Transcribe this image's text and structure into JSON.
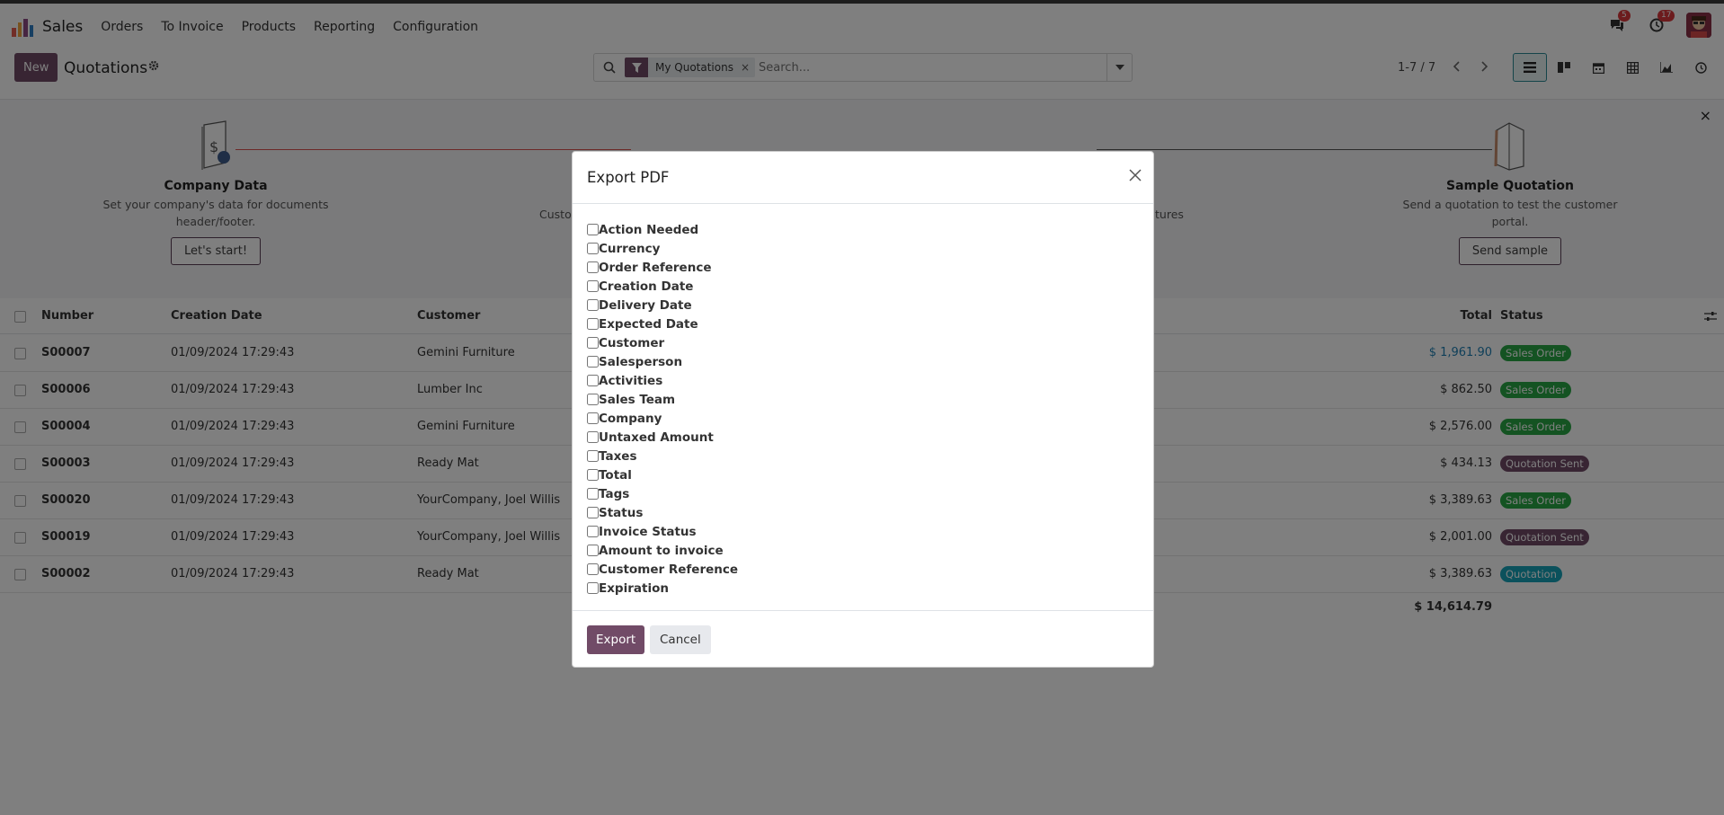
{
  "app": {
    "name": "Sales",
    "menu": [
      "Orders",
      "To Invoice",
      "Products",
      "Reporting",
      "Configuration"
    ],
    "messages_count": "5",
    "activities_count": "17"
  },
  "control": {
    "new_label": "New",
    "title": "Quotations",
    "facet_label": "My Quotations",
    "facet_remove": "×",
    "search_placeholder": "Search...",
    "pager": "1-7 / 7"
  },
  "onboarding": {
    "close": "×",
    "steps": [
      {
        "title": "Company Data",
        "desc_line1": "Set your company's data for documents",
        "desc_line2": "header/footer.",
        "button": "Let's start!"
      },
      {
        "title": "",
        "desc_line1": "Custo",
        "desc_line2": "",
        "button": ""
      },
      {
        "title": "",
        "desc_line1": "tures",
        "desc_line2": "",
        "button": ""
      },
      {
        "title": "Sample Quotation",
        "desc_line1": "Send a quotation to test the customer",
        "desc_line2": "portal.",
        "button": "Send sample"
      }
    ]
  },
  "table": {
    "headers": {
      "number": "Number",
      "creation_date": "Creation Date",
      "customer": "Customer",
      "total": "Total",
      "status": "Status"
    },
    "rows": [
      {
        "number": "S00007",
        "date": "01/09/2024 17:29:43",
        "customer": "Gemini Furniture",
        "total": "$ 1,961.90",
        "status": "Sales Order"
      },
      {
        "number": "S00006",
        "date": "01/09/2024 17:29:43",
        "customer": "Lumber Inc",
        "total": "$ 862.50",
        "status": "Sales Order"
      },
      {
        "number": "S00004",
        "date": "01/09/2024 17:29:43",
        "customer": "Gemini Furniture",
        "total": "$ 2,576.00",
        "status": "Sales Order"
      },
      {
        "number": "S00003",
        "date": "01/09/2024 17:29:43",
        "customer": "Ready Mat",
        "total": "$ 434.13",
        "status": "Quotation Sent"
      },
      {
        "number": "S00020",
        "date": "01/09/2024 17:29:43",
        "customer": "YourCompany, Joel Willis",
        "total": "$ 3,389.63",
        "status": "Sales Order"
      },
      {
        "number": "S00019",
        "date": "01/09/2024 17:29:43",
        "customer": "YourCompany, Joel Willis",
        "total": "$ 2,001.00",
        "status": "Quotation Sent"
      },
      {
        "number": "S00002",
        "date": "01/09/2024 17:29:43",
        "customer": "Ready Mat",
        "total": "$ 3,389.63",
        "status": "Quotation"
      }
    ],
    "grand_total": "$ 14,614.79"
  },
  "status_colors": {
    "Sales Order": "#28a745",
    "Quotation Sent": "#714b67",
    "Quotation": "#17a2b8"
  },
  "modal": {
    "title": "Export PDF",
    "fields": [
      "Action Needed",
      "Currency",
      "Order Reference",
      "Creation Date",
      "Delivery Date",
      "Expected Date",
      "Customer",
      "Salesperson",
      "Activities",
      "Sales Team",
      "Company",
      "Untaxed Amount",
      "Taxes",
      "Total",
      "Tags",
      "Status",
      "Invoice Status",
      "Amount to invoice",
      "Customer Reference",
      "Expiration"
    ],
    "export_label": "Export",
    "cancel_label": "Cancel"
  }
}
